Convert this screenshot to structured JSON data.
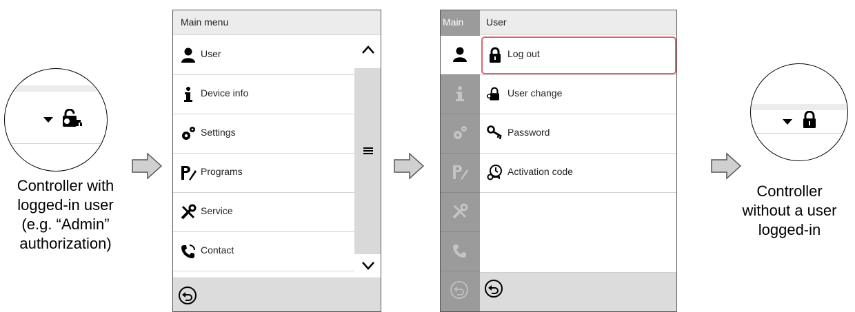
{
  "left_caption": [
    "Controller with",
    "logged-in user",
    "(e.g. “Admin”",
    "authorization)"
  ],
  "right_caption": [
    "Controller",
    "without a user",
    "logged-in"
  ],
  "main_menu": {
    "title": "Main menu",
    "items": [
      {
        "label": "User",
        "icon": "user-icon"
      },
      {
        "label": "Device info",
        "icon": "info-icon"
      },
      {
        "label": "Settings",
        "icon": "gears-icon"
      },
      {
        "label": "Programs",
        "icon": "programs-icon"
      },
      {
        "label": "Service",
        "icon": "tools-icon"
      },
      {
        "label": "Contact",
        "icon": "phone-icon"
      }
    ]
  },
  "user_menu": {
    "side_label": "Main",
    "title": "User",
    "items": [
      {
        "label": "Log out",
        "icon": "lock-icon",
        "highlighted": true
      },
      {
        "label": "User change",
        "icon": "user-change-icon"
      },
      {
        "label": "Password",
        "icon": "key-icon"
      },
      {
        "label": "Activation code",
        "icon": "activation-icon"
      }
    ]
  },
  "colors": {
    "highlight": "#e0626c",
    "sidebar": "#9b9b9b",
    "bar": "#ececec"
  }
}
